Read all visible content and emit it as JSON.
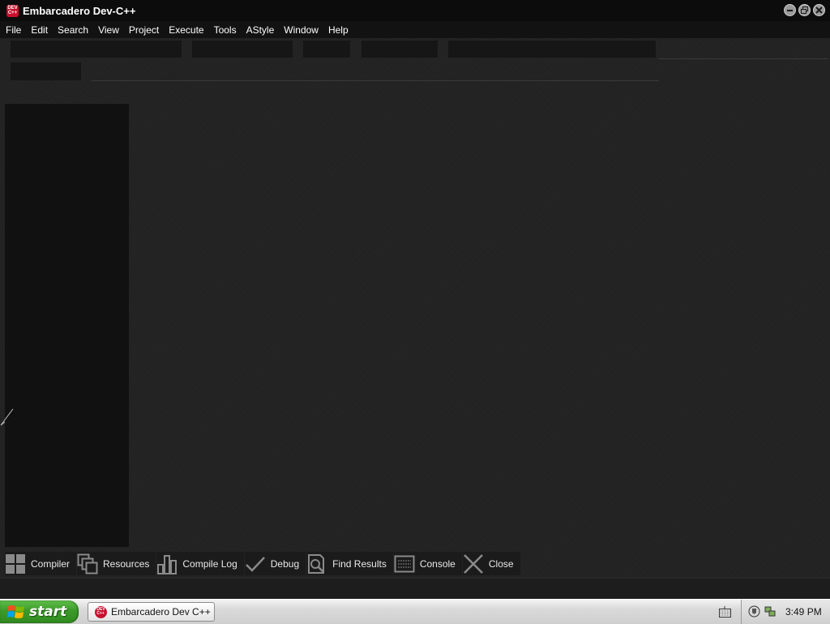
{
  "window": {
    "title": "Embarcadero Dev-C++",
    "logo_text": "DEV C++"
  },
  "menu": [
    "File",
    "Edit",
    "Search",
    "View",
    "Project",
    "Execute",
    "Tools",
    "AStyle",
    "Window",
    "Help"
  ],
  "bottom_tabs": [
    {
      "label": "Compiler",
      "icon": "grid-icon"
    },
    {
      "label": "Resources",
      "icon": "windows-stack-icon"
    },
    {
      "label": "Compile Log",
      "icon": "bar-chart-icon"
    },
    {
      "label": "Debug",
      "icon": "checkmark-icon"
    },
    {
      "label": "Find Results",
      "icon": "document-search-icon"
    },
    {
      "label": "Console",
      "icon": "console-icon"
    },
    {
      "label": "Close",
      "icon": "close-x-icon"
    }
  ],
  "taskbar": {
    "start_label": "start",
    "task_button_label": "Embarcadero Dev C++",
    "clock": "3:49 PM"
  },
  "colors": {
    "background": "#232323",
    "title_bar": "#0c0c0c",
    "menu_bar": "#121212",
    "left_panel": "#111111",
    "logo_red": "#c8102e",
    "start_green": "#3c9a2a"
  }
}
